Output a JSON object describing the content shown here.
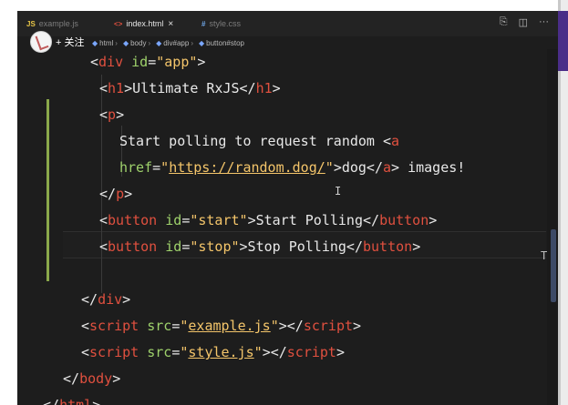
{
  "tabs": [
    {
      "icon": "JS",
      "label": "example.js"
    },
    {
      "icon": "<>",
      "label": "index.html"
    },
    {
      "icon": "#",
      "label": "style.css"
    }
  ],
  "tab_close": "×",
  "breadcrumb": [
    "html",
    "body",
    "div#app",
    "button#stop"
  ],
  "follow_label": "+ 关注",
  "top_actions": [
    "⎘",
    "◫",
    "···"
  ],
  "code_lines": [
    {
      "indent": "    ",
      "parts": [
        [
          "p",
          "<"
        ],
        [
          "tag",
          "div"
        ],
        [
          "p",
          " "
        ],
        [
          "attr",
          "id"
        ],
        [
          "p",
          "="
        ],
        [
          "str",
          "\"app\""
        ],
        [
          "p",
          ">"
        ]
      ]
    },
    {
      "indent": "      ",
      "parts": [
        [
          "p",
          "<"
        ],
        [
          "tag",
          "h1"
        ],
        [
          "p",
          ">Ultimate RxJS</"
        ],
        [
          "tag",
          "h1"
        ],
        [
          "p",
          ">"
        ]
      ]
    },
    {
      "indent": "      ",
      "parts": [
        [
          "p",
          "<"
        ],
        [
          "tag",
          "p"
        ],
        [
          "p",
          ">"
        ]
      ]
    },
    {
      "indent": "        ",
      "parts": [
        [
          "p",
          "Start polling to request random <"
        ],
        [
          "tag",
          "a"
        ]
      ]
    },
    {
      "indent": "        ",
      "parts": [
        [
          "attr",
          "href"
        ],
        [
          "p",
          "="
        ],
        [
          "str",
          "\""
        ],
        [
          "strlink",
          "https://random.dog/"
        ],
        [
          "str",
          "\""
        ],
        [
          "p",
          ">dog</"
        ],
        [
          "tag",
          "a"
        ],
        [
          "p",
          "> images!"
        ]
      ]
    },
    {
      "indent": "      ",
      "parts": [
        [
          "p",
          "</"
        ],
        [
          "tag",
          "p"
        ],
        [
          "p",
          ">"
        ]
      ]
    },
    {
      "indent": "      ",
      "parts": [
        [
          "p",
          "<"
        ],
        [
          "tag",
          "button"
        ],
        [
          "p",
          " "
        ],
        [
          "attr",
          "id"
        ],
        [
          "p",
          "="
        ],
        [
          "str",
          "\"start\""
        ],
        [
          "p",
          ">Start Polling</"
        ],
        [
          "tag",
          "button"
        ],
        [
          "p",
          ">"
        ]
      ]
    },
    {
      "indent": "      ",
      "parts": [
        [
          "p",
          "<"
        ],
        [
          "tag",
          "button"
        ],
        [
          "p",
          " "
        ],
        [
          "attr",
          "id"
        ],
        [
          "p",
          "="
        ],
        [
          "str",
          "\"stop\""
        ],
        [
          "p",
          ">Stop Polling</"
        ],
        [
          "tag",
          "button"
        ],
        [
          "p",
          ">"
        ]
      ]
    },
    {
      "indent": "",
      "parts": []
    },
    {
      "indent": "    ",
      "parts": [
        [
          "p",
          "</"
        ],
        [
          "tag",
          "div"
        ],
        [
          "p",
          ">"
        ]
      ]
    },
    {
      "indent": "    ",
      "parts": [
        [
          "p",
          "<"
        ],
        [
          "tag",
          "script"
        ],
        [
          "p",
          " "
        ],
        [
          "attr",
          "src"
        ],
        [
          "p",
          "="
        ],
        [
          "str",
          "\""
        ],
        [
          "strlink",
          "example.js"
        ],
        [
          "str",
          "\""
        ],
        [
          "p",
          "></"
        ],
        [
          "tag",
          "script"
        ],
        [
          "p",
          ">"
        ]
      ]
    },
    {
      "indent": "    ",
      "parts": [
        [
          "p",
          "<"
        ],
        [
          "tag",
          "script"
        ],
        [
          "p",
          " "
        ],
        [
          "attr",
          "src"
        ],
        [
          "p",
          "="
        ],
        [
          "str",
          "\""
        ],
        [
          "strlink",
          "style.js"
        ],
        [
          "str",
          "\""
        ],
        [
          "p",
          "></"
        ],
        [
          "tag",
          "script"
        ],
        [
          "p",
          ">"
        ]
      ]
    },
    {
      "indent": "  ",
      "parts": [
        [
          "p",
          "</"
        ],
        [
          "tag",
          "body"
        ],
        [
          "p",
          ">"
        ]
      ]
    },
    {
      "indent": "",
      "parts": [
        [
          "p",
          "</"
        ],
        [
          "tag",
          "html"
        ],
        [
          "p",
          ">"
        ]
      ]
    }
  ],
  "cursor_glyph": "I",
  "ibeam_glyph": "T"
}
